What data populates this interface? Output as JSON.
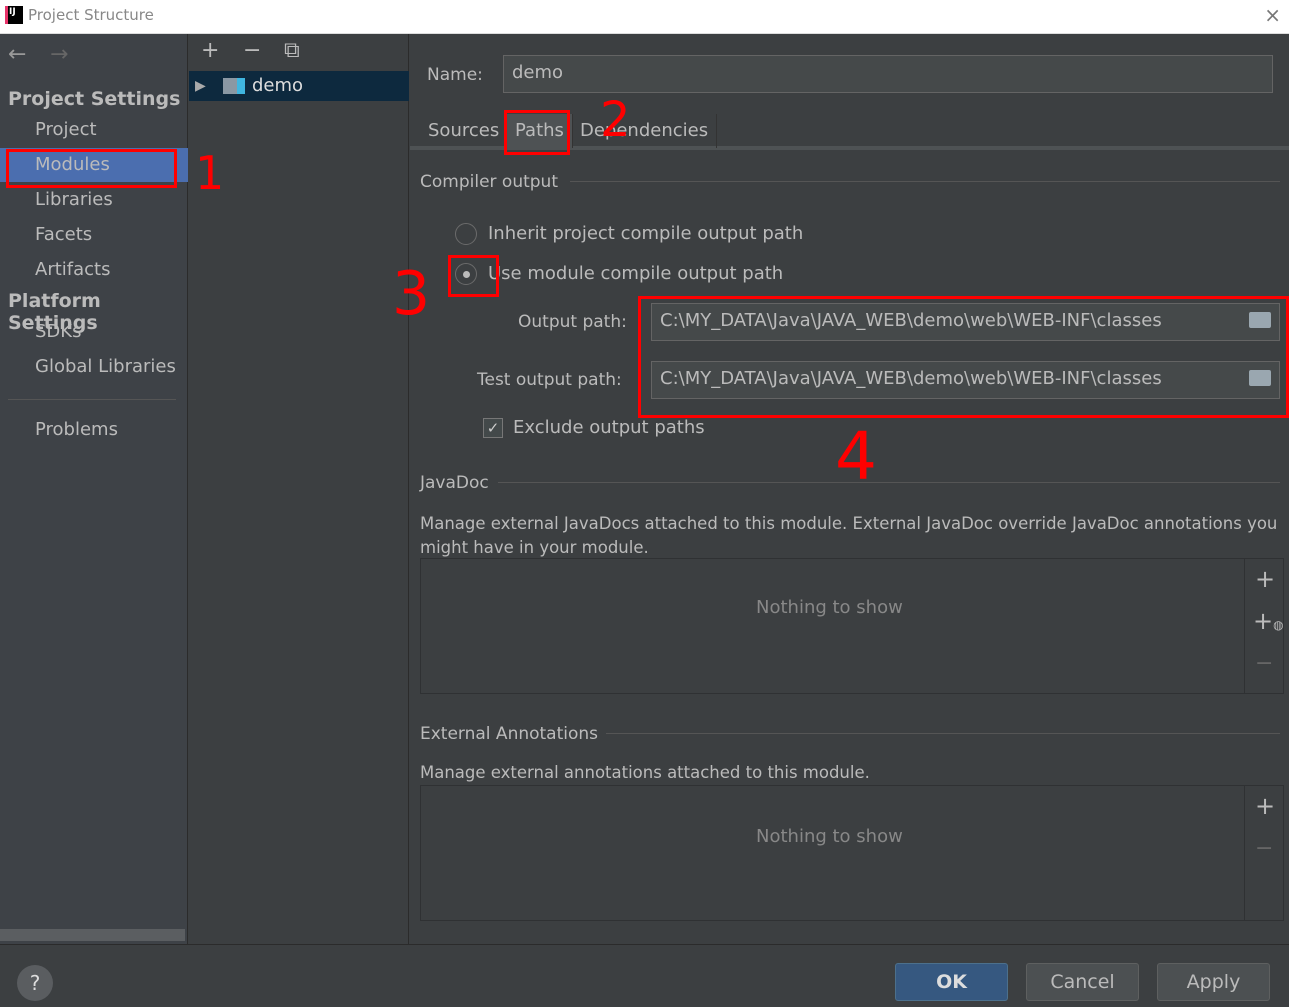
{
  "window": {
    "title": "Project Structure",
    "close_icon": "×"
  },
  "sidebar": {
    "back": "←",
    "forward": "→",
    "project_settings": "Project Settings",
    "project_items": [
      {
        "label": "Project"
      },
      {
        "label": "Modules",
        "selected": true
      },
      {
        "label": "Libraries"
      },
      {
        "label": "Facets"
      },
      {
        "label": "Artifacts"
      }
    ],
    "platform_settings": "Platform Settings",
    "platform_items": [
      {
        "label": "SDKs"
      },
      {
        "label": "Global Libraries"
      }
    ],
    "problems": "Problems"
  },
  "tree": {
    "add": "+",
    "remove": "−",
    "copy": "⧉",
    "module": "demo",
    "expand": "▶"
  },
  "main": {
    "name_label": "Name:",
    "name_value": "demo",
    "tabs": [
      {
        "label": "Sources"
      },
      {
        "label": "Paths",
        "selected": true
      },
      {
        "label": "Dependencies"
      }
    ],
    "compiler": {
      "title": "Compiler output",
      "inherit": "Inherit project compile output path",
      "use_module": "Use module compile output path",
      "selected": "use_module",
      "output_label": "Output path:",
      "output_value": "C:\\MY_DATA\\Java\\JAVA_WEB\\demo\\web\\WEB-INF\\classes",
      "test_label": "Test output path:",
      "test_value": "C:\\MY_DATA\\Java\\JAVA_WEB\\demo\\web\\WEB-INF\\classes",
      "exclude": "Exclude output paths",
      "exclude_checked": true
    },
    "javadoc": {
      "title": "JavaDoc",
      "desc": "Manage external JavaDocs attached to this module. External JavaDoc override JavaDoc annotations you might have in your module.",
      "empty": "Nothing to show"
    },
    "annotations": {
      "title": "External Annotations",
      "desc": "Manage external annotations attached to this module.",
      "empty": "Nothing to show"
    }
  },
  "annotations_marks": [
    "1",
    "2",
    "3",
    "4"
  ],
  "footer": {
    "help": "?",
    "ok": "OK",
    "cancel": "Cancel",
    "apply": "Apply"
  },
  "colors": {
    "selection": "#4b6eaf",
    "annotation": "#ff0000",
    "ok": "#365880"
  }
}
